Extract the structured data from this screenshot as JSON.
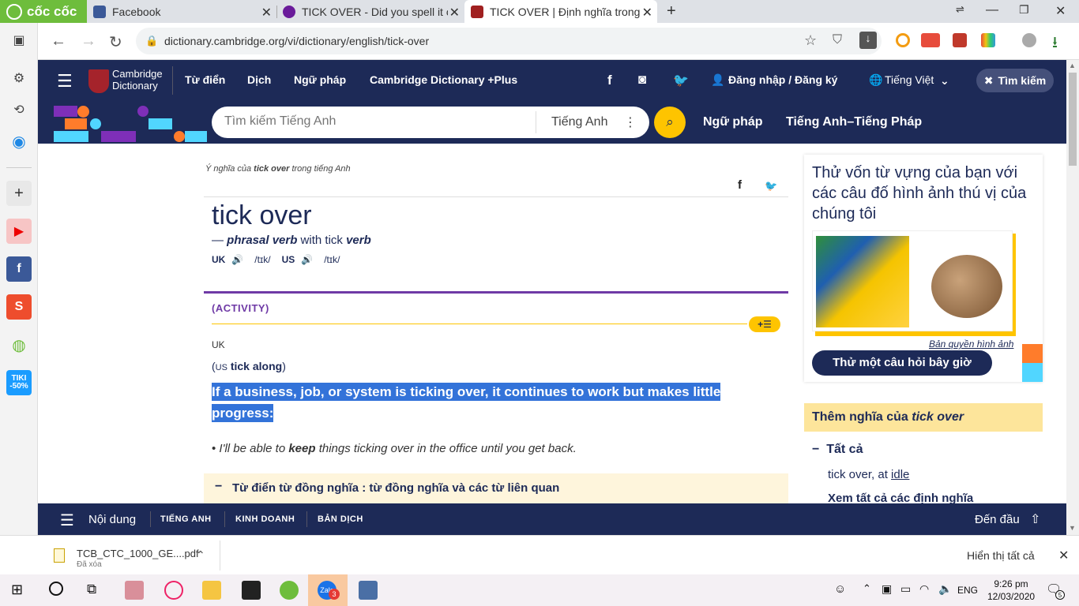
{
  "browser": {
    "brand": "cốc cốc",
    "tabs": [
      {
        "title": "Facebook",
        "color": "#3b5998"
      },
      {
        "title": "TICK OVER - Did you spell it c",
        "color": "#6a1b9a"
      },
      {
        "title": "TICK OVER | Định nghĩa trong",
        "color": "#a02020"
      }
    ],
    "url": "dictionary.cambridge.org/vi/dictionary/english/tick-over"
  },
  "site": {
    "logo_line1": "Cambridge",
    "logo_line2": "Dictionary",
    "nav": [
      "Từ điển",
      "Dịch",
      "Ngữ pháp",
      "Cambridge Dictionary +Plus"
    ],
    "login": "Đăng nhập / Đăng ký",
    "language": "Tiếng Việt",
    "search_button": "Tìm kiếm",
    "search_placeholder": "Tìm kiếm Tiếng Anh",
    "search_lang": "Tiếng Anh",
    "sub_links": [
      "Ngữ pháp",
      "Tiếng Anh–Tiếng Pháp"
    ]
  },
  "entry": {
    "breadcrumb_pre": "Ý nghĩa của ",
    "breadcrumb_word": "tick over",
    "breadcrumb_post": " trong tiếng Anh",
    "headword": "tick over",
    "pos_dash": "— ",
    "pos": "phrasal verb",
    "pos_with": " with tick ",
    "pos_verb": "verb",
    "uk_label": "UK",
    "uk_ipa": "/tɪk/",
    "us_label": "US",
    "us_ipa": "/tɪk/",
    "guideword": "(ACTIVITY)",
    "region": "UK",
    "variant_open": "(",
    "variant_us": "US",
    "variant_word": "tick along",
    "variant_close": ")",
    "definition": "If a business, job, or system is ticking over, it continues to work but makes little progress:",
    "example_pre": "I'll be able to ",
    "example_bold": "keep",
    "example_post": " things ticking over in the office until you get back.",
    "thesaurus": "Từ điển từ đồng nghĩa : từ đồng nghĩa và các từ liên quan"
  },
  "sidebar_right": {
    "quiz_title": "Thử vốn từ vựng của bạn với các câu đố hình ảnh thú vị của chúng tôi",
    "copyright": "Bản quyền hình ảnh",
    "quiz_button": "Thử một câu hỏi bây giờ",
    "more_pre": "Thêm nghĩa của ",
    "more_word": "tick over",
    "all_label": "Tất cả",
    "related_pre": "tick over, at ",
    "related_link": "idle",
    "see_all": "Xem tất cả các định nghĩa"
  },
  "bottom_nav": {
    "menu": "Nội dung",
    "links": [
      "TIẾNG ANH",
      "KINH DOANH",
      "BẢN DỊCH"
    ],
    "top": "Đến đầu"
  },
  "download": {
    "filename": "TCB_CTC_1000_GE....pdf",
    "status": "Đã xóa",
    "show_all": "Hiển thị tất cả"
  },
  "taskbar": {
    "lang": "ENG",
    "time": "9:26 pm",
    "date": "12/03/2020",
    "notif": "5",
    "zalo_badge": "3"
  },
  "colors": {
    "navy": "#1d2a57",
    "yellow": "#fec400",
    "highlight": "#3373d9"
  }
}
